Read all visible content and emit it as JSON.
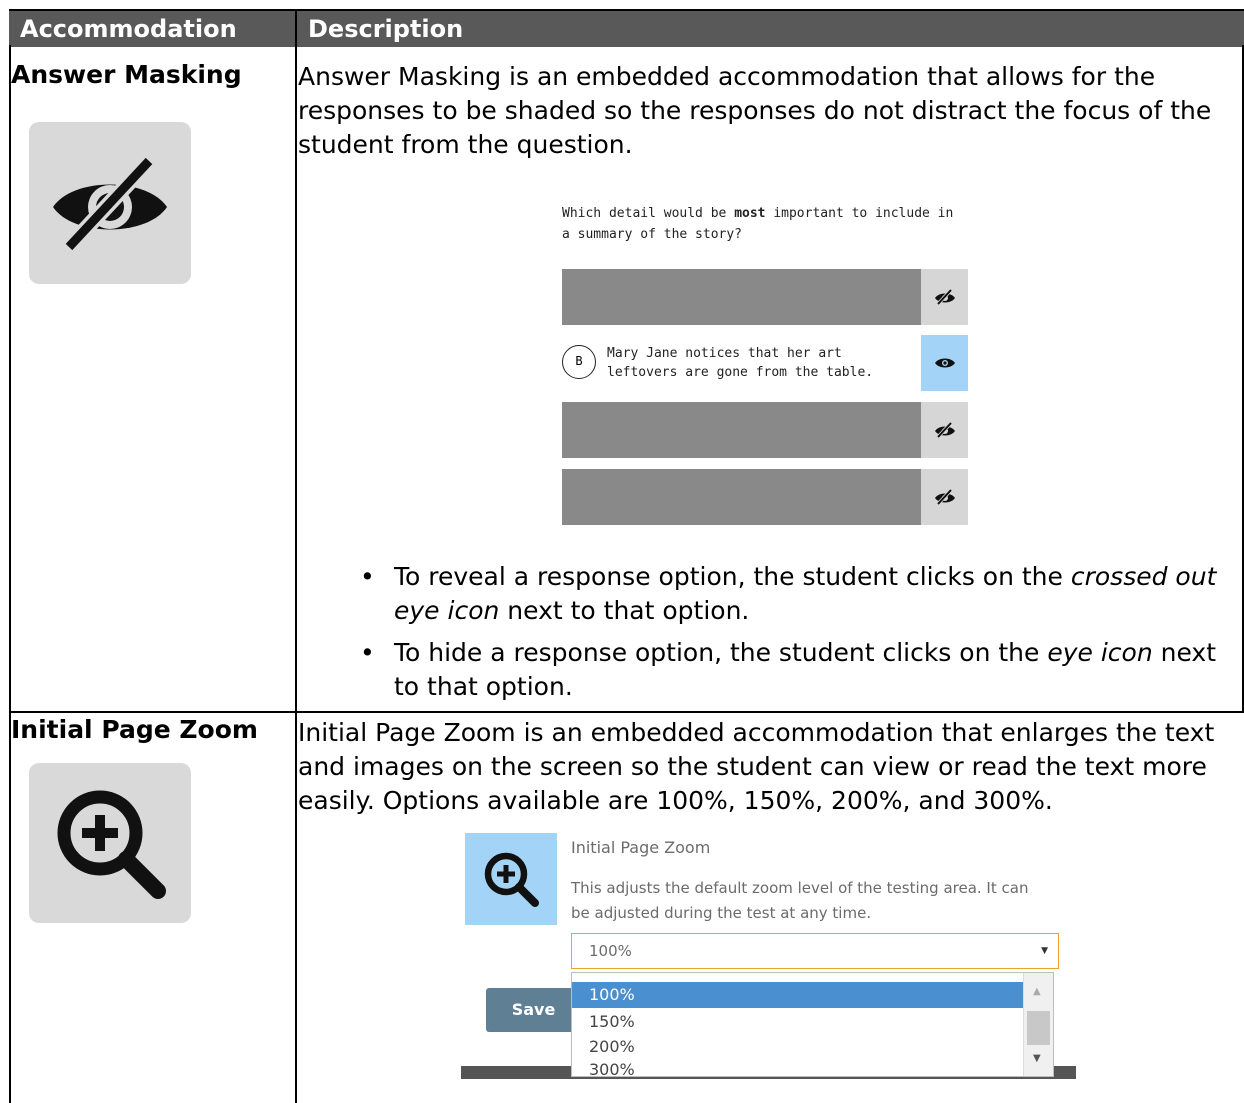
{
  "table": {
    "headers": {
      "accommodation": "Accommodation",
      "description": "Description"
    },
    "rows": [
      {
        "name": "Answer Masking",
        "icon": "crossed-out-eye-icon",
        "description": "Answer Masking is an embedded accommodation that allows for the responses to be shaded so the responses do not distract the focus of the student from the question.",
        "bullets": [
          {
            "pre": "To reveal a response option, the student clicks on the ",
            "em": "crossed out eye icon",
            "post": " next to that option."
          },
          {
            "pre": "To hide a response option, the student clicks on the ",
            "em": "eye icon",
            "post": " next to that option."
          }
        ]
      },
      {
        "name": "Initial Page Zoom",
        "icon": "zoom-in-icon",
        "description": "Initial Page Zoom is an embedded accommodation that enlarges the text and images on the screen so the student can view or read the text more easily. Options available are 100%, 150%, 200%, and 300%."
      }
    ]
  },
  "masking_example": {
    "question_pre": "Which detail would be ",
    "question_bold": "most",
    "question_post": " important to include in a summary of the story?",
    "options": [
      {
        "state": "masked"
      },
      {
        "state": "revealed",
        "letter": "B",
        "text": "Mary Jane notices that her art leftovers are gone from the table."
      },
      {
        "state": "masked"
      },
      {
        "state": "masked"
      }
    ]
  },
  "zoom_example": {
    "title": "Initial Page Zoom",
    "description": "This adjusts the default zoom level of the testing area. It can be adjusted during the test at any time.",
    "selected": "100%",
    "options": [
      "100%",
      "150%",
      "200%",
      "300%"
    ],
    "save_label": "Save"
  },
  "colors": {
    "header_bg": "#595959",
    "icon_tile": "#d9d9d9",
    "masked": "#898989",
    "eye_active": "#a3d4f7",
    "dropdown_selected": "#4a8fd0"
  }
}
